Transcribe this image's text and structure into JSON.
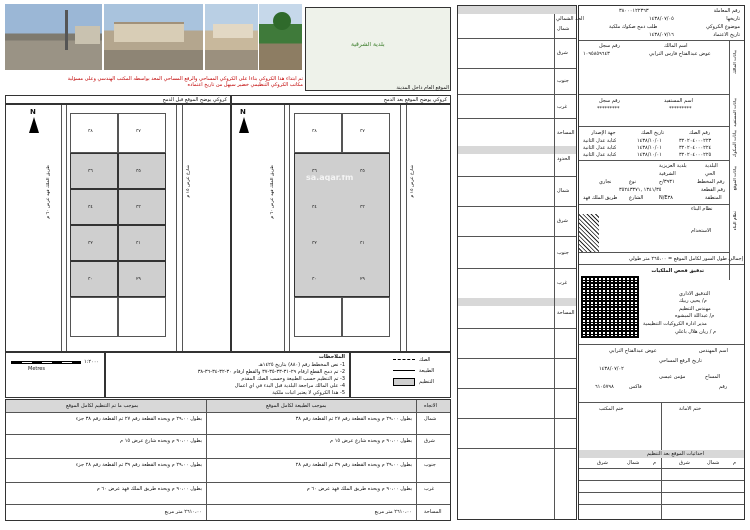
{
  "photos": [
    "photo-street-1",
    "photo-street-2",
    "photo-street-3",
    "photo-building-4"
  ],
  "map_top": {
    "municipality": "بلدية الشرقية",
    "general_location_caption": "الموقع العام داخل المدينة"
  },
  "notice": {
    "line1": "تم ابتداء هذا الكروكي بناءا على الكروكي المساحي والرفع المساحي المعد بواسطه المكتب الهندسي وعلى مسؤلية",
    "line2": "مكاتب الكروكي التنظيمي خضير سيهل من تاريخ اعتماده"
  },
  "panels": {
    "before_title": "كروكي يوضح الموقع قبل الدمج",
    "after_title": "كروكي يوضح الموقع بعد الدمج",
    "watermark": "sa.aqar.fm",
    "lot_numbers": [
      "٣٨",
      "٣٦",
      "٣٤",
      "٣٢",
      "٣٠",
      "٣٧",
      "٣٥",
      "٣٣",
      "٣١",
      "٢٩"
    ],
    "north": "N"
  },
  "scale": {
    "label": "Metres",
    "ratio": "١:٢٠٠٠"
  },
  "legend": {
    "title": "الملاحظات",
    "key_deed": "الصك",
    "key_nature": "الطبيعة",
    "key_plan": "التنظيم",
    "notes": [
      "1- نص المخطط رقم (٨٨٠) بتاريخ ١٤٢٥هـ",
      "2- تم دمج القطع ارقام ٢٩-٣١-٣٣-٣٥-٣٧ والقطع ارقام ٣٠-٣٢-٣٤-٣٦-٣٨",
      "3- تم التنظيم حسب الطبيعة وحسب الصك المقدم",
      "4- على المالك مراجعة البلدية قبل البدء في اي اعمال",
      "5- هذا الكروكي لا يعتبر اثبات ملكية"
    ]
  },
  "bounds_table": {
    "col_nature": "بموجب الطبيعة لكامل الموقع",
    "col_plan": "بموجب ما تم التنظيم لكامل الموقع",
    "col_dir": "الاتجاه",
    "rows": [
      {
        "dir": "شمال",
        "nature": "بطول ٢٩،٠٠ م ويحده القطعة رقم ٢٧ ثم القطعة رقم ٣٨",
        "plan": "بطول ٢٩،٠٠ م ويحده القطعة رقم ٢٧ ثم القطعة رقم ٣٨ جزء"
      },
      {
        "dir": "شرق",
        "nature": "بطول ٩٠،٠٠ م ويحده شارع عرض ١٥ م",
        "plan": "بطول ٩٠،٠٠ م ويحده شارع عرض ١٥ م"
      },
      {
        "dir": "جنوب",
        "nature": "بطول ٢٩،٠٠ م ويحده القطعة رقم ٣٩ ثم القطعة رقم ٢٨",
        "plan": "بطول ٢٩،٠٠ م ويحده القطعة رقم ٣٩ ثم القطعة رقم ٢٨ جزء"
      },
      {
        "dir": "غرب",
        "nature": "بطول ٩٠،٠٠ م ويحده طريق الملك فهد عرض ٦٠ م",
        "plan": "بطول ٩٠،٠٠ م ويحده طريق الملك فهد عرض ٦٠ م"
      },
      {
        "dir": "المساحة",
        "nature": "٢٦١٠،٠٠ متر مربع",
        "plan": "٢٦١٠،٠٠ متر مربع"
      }
    ]
  },
  "mid_column": {
    "items": [
      "الحد الشمالي",
      "شمال",
      "شرق",
      "جنوب",
      "غرب",
      "المساحة",
      "الحدود",
      "شمال",
      "شرق",
      "جنوب",
      "غرب",
      "المساحة"
    ]
  },
  "right_panel": {
    "request_no_label": "رقم المعاملة",
    "request_no": "٣٨٠٠٠١٢٢٣٦٣",
    "date_label": "تاريخها",
    "date": "١٤٣٨/٠٧/٠٥",
    "subject_label": "موضوع الكروكي",
    "subject": "طلب دمج صكوك ملكية",
    "approval_date_label": "تاريخ الاعتماد",
    "approval_date": "١٤٣٨/٠٧/١٦",
    "owner_section": "بيانات المالك",
    "owner_name_label": "اسم المالك",
    "owner_name": "عوض عبدالفتاح فارس الترابي",
    "owner_id_label": "رقم سجل",
    "owner_id": "١٠٩٥٨٥٩٦٤٣",
    "beneficiary_section": "بيانات المستفيد",
    "beneficiary_name_label": "اسم المستفيد",
    "beneficiary_id_label": "رقم سجل",
    "beneficiary_name": "*********",
    "beneficiary_id": "*********",
    "deed_section": "بيانات الصكوك",
    "deed_headers": [
      "رقم الصك",
      "تاريخ الصك",
      "جهة الإصدار"
    ],
    "deeds": [
      [
        "٣٢٠٢٠٤٠٠٠٢٢٣",
        "١٤٣٨/١٠/٠١",
        "كتابة عدل الثانية"
      ],
      [
        "٣٢٠٢٠٤٠٠٠٢٢٤",
        "١٤٣٨/١٠/٠١",
        "كتابة عدل الثانية"
      ],
      [
        "٣٢٠٢٠٤٠٠٠٢٢٥",
        "١٤٣٨/١٠/٠١",
        "كتابة عدل الثانية"
      ]
    ],
    "site_section": "بيانات الموقع",
    "municipality_label": "البلدية",
    "municipality": "بلدية العزيزية",
    "district_label": "الحي",
    "district": "الشرقية",
    "plan_no_label": "رقم المخطط",
    "plan_no": "٣٩٣١/ح",
    "use_label": "نوع",
    "use": "تجاري",
    "lot_label": "رقم القطعة",
    "lot_no": "١٣٤١/٣٥ ,٣٥٢٤٣٣٧١",
    "zone_label": "المنطقة",
    "zone": "N/E٣٨",
    "street_label": "الشارع",
    "street": "طريق الملك فهد",
    "build_section": "نظام البناء",
    "build_system_label": "نظام البناء",
    "usage_label": "الاستخدام",
    "total_length": "إجمالي طول السور لكامل الموقع = ٢٦٥،٠٠ متر طولي",
    "audit_title": "تدقيق فحص الملكيات",
    "admin_audit_label": "التدقيق الاداري",
    "admin_audit_name": "م/ يحيى ربيك",
    "plan_eng_label": "مهندس التنظيم",
    "plan_eng_name": "م/ عبداللة المبشوه",
    "director_label": "مدير ادارة الكروكيات التنظيمية",
    "director_name": "م / ريان هلال باعلي",
    "engineer_label": "اسم المهندس",
    "engineer_name": "عوض عبدالفتاح الترابي",
    "survey_date_label": "تاريخ الرفع المساحي",
    "survey_date": "١٤٣٨/٠٧/٠٢",
    "surveyor_label": "المساح",
    "surveyor": "مؤمن عيسى",
    "office_no_label": "رقم",
    "office_no": "٦١٠٥٧٩٨",
    "fax_label": "فاكس",
    "stamp_office": "ختم المكتب",
    "stamp_municipality": "ختم الامانة",
    "bottom_table_title": "احداثيات الموقع بعد التنظيم",
    "bottom_headers": [
      "م",
      "شمال",
      "شرق",
      "م",
      "شمال",
      "شرق"
    ]
  }
}
